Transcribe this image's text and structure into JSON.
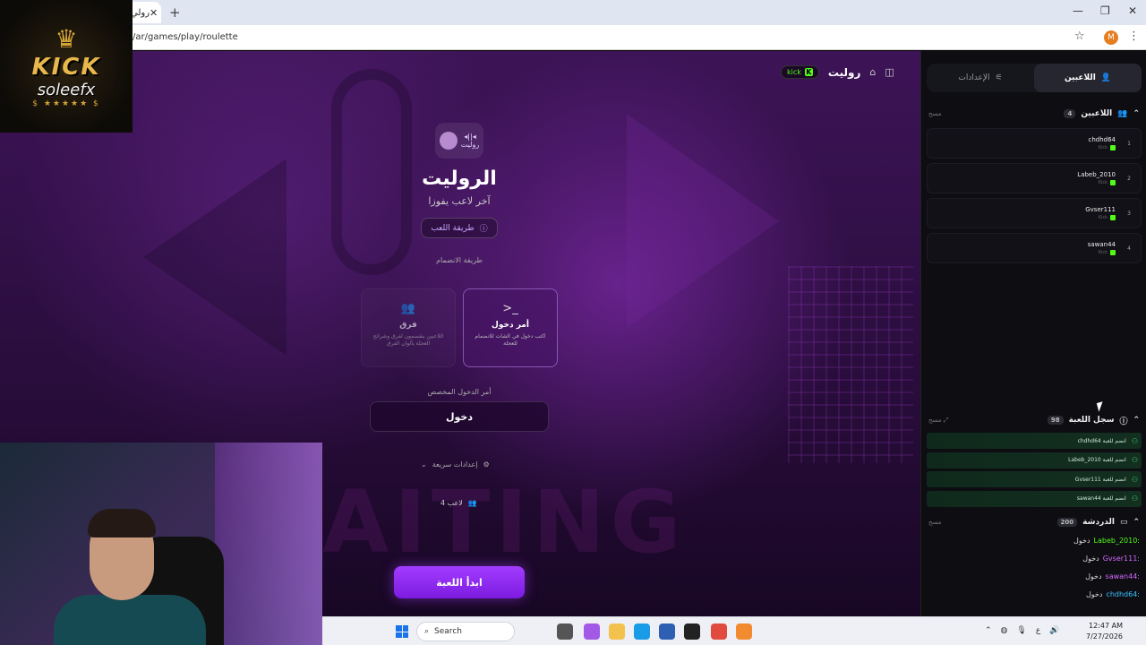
{
  "browser": {
    "tab_label": "رولي",
    "url": "/ar/games/play/roulette"
  },
  "brand": {
    "line1": "KICK",
    "line2": "soleefx",
    "stars": "$ ★★★★★ $"
  },
  "game": {
    "nav_title": "روليت",
    "kick_label": "kick",
    "logo_text": "روليت",
    "logo_mark": "◂||◂",
    "title": "الروليت",
    "subtitle": "آخر لاعب يفوزا",
    "howto_label": "طريقة اللعب",
    "join_method_label": "طريقة الانضمام",
    "modes": [
      {
        "title": "فرق",
        "desc": "اللاعبين ينقسمون لفرق وشرائح العجلة بألوان الفرق"
      },
      {
        "title": "أمر دخول",
        "desc": "اكتب دخول في الشات للانضمام للعجلة"
      }
    ],
    "custom_cmd_label": "أمر الدخول المخصص",
    "custom_cmd_value": "دخول",
    "quick_settings": "إعدادات سريعة",
    "player_count": "4 لاعب",
    "start_button": "ابدأ اللعبة",
    "bg_word": "AITING"
  },
  "panel": {
    "tabs": {
      "players": "اللاعبين",
      "settings": "الإعدادات"
    },
    "players_section": {
      "title": "اللاعبين",
      "count": "4",
      "clear": "مسح"
    },
    "players": [
      {
        "rank": "1",
        "name": "chdhd64",
        "platform": "Kick"
      },
      {
        "rank": "2",
        "name": "Labeb_2010",
        "platform": "Kick"
      },
      {
        "rank": "3",
        "name": "Gvser111",
        "platform": "Kick"
      },
      {
        "rank": "4",
        "name": "sawan44",
        "platform": "Kick"
      }
    ],
    "log_section": {
      "title": "سجل اللعبة",
      "count": "98",
      "clear": "مسح"
    },
    "log": [
      "chdhd64 انضم للعبة",
      "Labeb_2010 انضم للعبة",
      "Gvser111 انضم للعبة",
      "sawan44 انضم للعبة"
    ],
    "chat_section": {
      "title": "الدردشة",
      "count": "200",
      "clear": "مسح"
    },
    "chat": [
      {
        "user": "Labeb_2010:",
        "msg": "دخول",
        "color": "#53fc18"
      },
      {
        "user": "Gvser111:",
        "msg": "دخول",
        "color": "#53fc18"
      },
      {
        "user": "sawan44:",
        "msg": "دخول",
        "color": "#d46bff"
      },
      {
        "user": "chdhd64:",
        "msg": "دخول",
        "color": "#3cc3ff"
      }
    ]
  },
  "taskbar": {
    "search_placeholder": "Search",
    "time": "12:47 AM",
    "date": "7/27/2026",
    "lang": "ع"
  },
  "colors": {
    "accent": "#a23cff",
    "kick_green": "#53fc18"
  }
}
